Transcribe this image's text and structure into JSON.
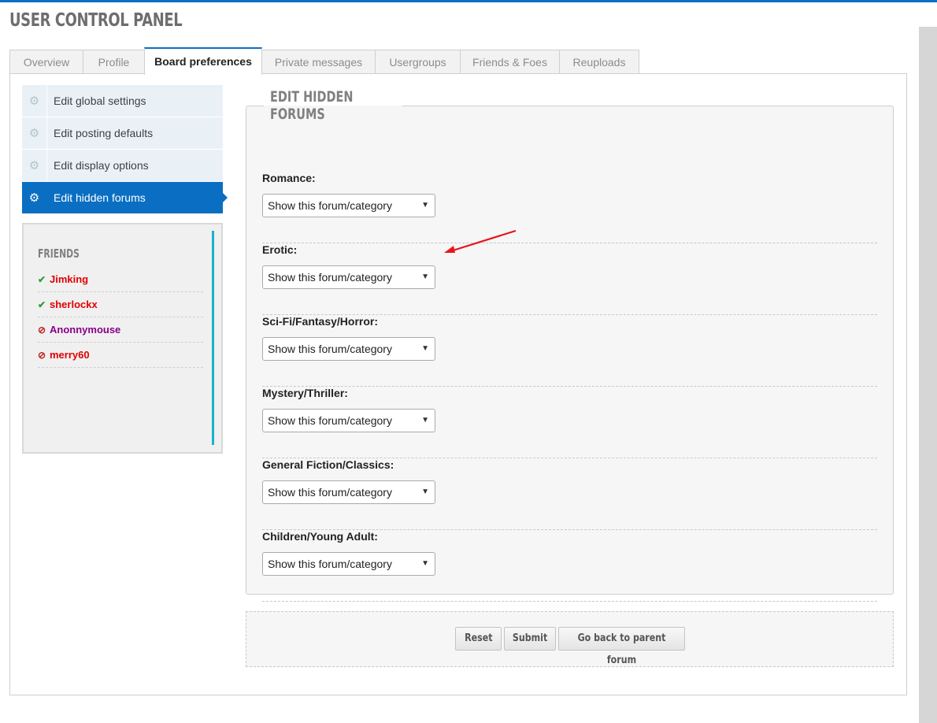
{
  "header": {
    "title": "USER CONTROL PANEL"
  },
  "tabs": [
    {
      "label": "Overview",
      "active": false
    },
    {
      "label": "Profile",
      "active": false
    },
    {
      "label": "Board preferences",
      "active": true
    },
    {
      "label": "Private messages",
      "active": false
    },
    {
      "label": "Usergroups",
      "active": false
    },
    {
      "label": "Friends & Foes",
      "active": false
    },
    {
      "label": "Reuploads",
      "active": false
    }
  ],
  "sidebar": {
    "items": [
      {
        "label": "Edit global settings",
        "icon": "gear-icon",
        "active": false
      },
      {
        "label": "Edit posting defaults",
        "icon": "gear-icon",
        "active": false
      },
      {
        "label": "Edit display options",
        "icon": "gear-icon",
        "active": false
      },
      {
        "label": "Edit hidden forums",
        "icon": "gear-icon",
        "active": true
      }
    ]
  },
  "friends": {
    "title": "FRIENDS",
    "list": [
      {
        "name": "Jimking",
        "status": "online",
        "icon": "check-circle-icon",
        "color": "#e00000"
      },
      {
        "name": "sherlockx",
        "status": "online",
        "icon": "check-circle-icon",
        "color": "#e00000"
      },
      {
        "name": "Anonnymouse",
        "status": "offline",
        "icon": "no-entry-icon",
        "color": "#880088"
      },
      {
        "name": "merry60",
        "status": "offline",
        "icon": "no-entry-icon",
        "color": "#e00000"
      }
    ]
  },
  "hidden_forums": {
    "legend": "EDIT HIDDEN FORUMS",
    "rows": [
      {
        "label": "Romance:",
        "value": "Show this forum/category"
      },
      {
        "label": "Erotic:",
        "value": "Show this forum/category"
      },
      {
        "label": "Sci-Fi/Fantasy/Horror:",
        "value": "Show this forum/category"
      },
      {
        "label": "Mystery/Thriller:",
        "value": "Show this forum/category"
      },
      {
        "label": "General Fiction/Classics:",
        "value": "Show this forum/category"
      },
      {
        "label": "Children/Young Adult:",
        "value": "Show this forum/category"
      }
    ]
  },
  "actions": {
    "reset": "Reset",
    "submit": "Submit",
    "back": "Go back to parent forum"
  },
  "colors": {
    "accent": "#0a6fc2",
    "friends_bar": "#1ab3cc",
    "annotation_arrow": "#e8141c"
  }
}
